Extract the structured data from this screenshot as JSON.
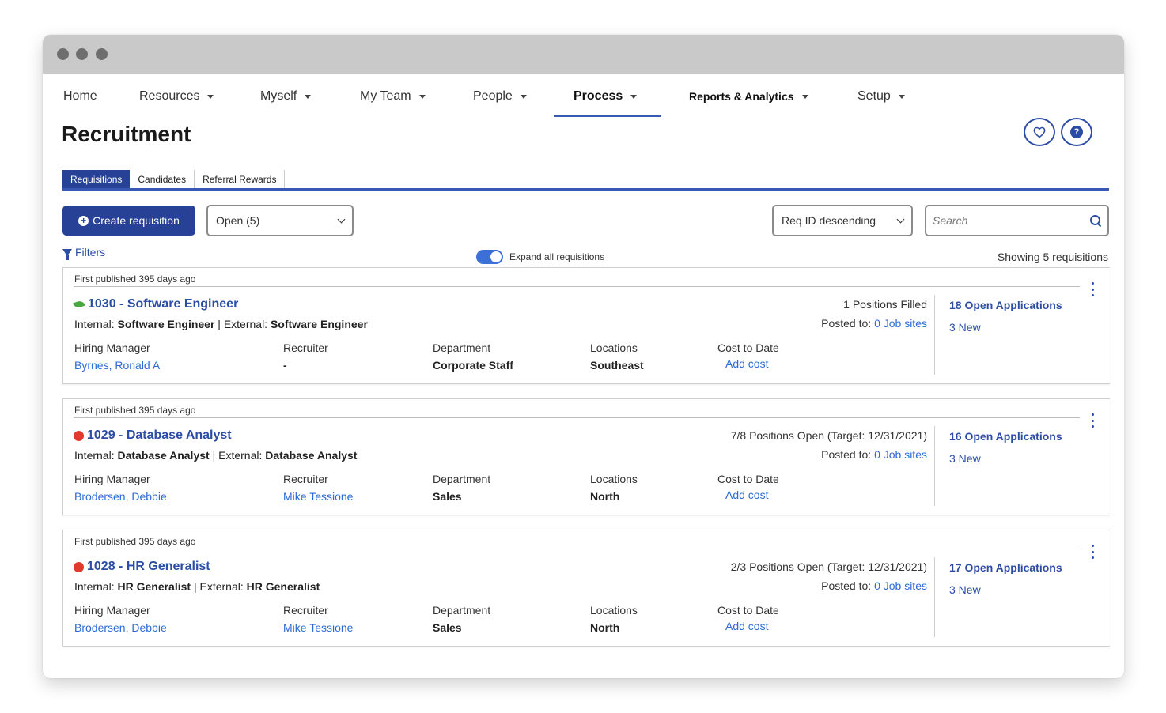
{
  "nav": {
    "items": [
      {
        "label": "Home"
      },
      {
        "label": "Resources"
      },
      {
        "label": "Myself"
      },
      {
        "label": "My Team"
      },
      {
        "label": "People"
      },
      {
        "label": "Process"
      },
      {
        "label": "Reports & Analytics"
      },
      {
        "label": "Setup"
      }
    ],
    "active": "Process"
  },
  "page": {
    "title": "Recruitment"
  },
  "subtabs": [
    {
      "label": "Requisitions"
    },
    {
      "label": "Candidates"
    },
    {
      "label": "Referral Rewards"
    }
  ],
  "toolbar": {
    "create_label": "Create requisition",
    "status_value": "Open (5)",
    "sort_value": "Req ID descending",
    "search_placeholder": "Search",
    "filters_label": "Filters",
    "expand_label": "Expand all requisitions",
    "expand_on": true,
    "showing": "Showing 5 requisitions"
  },
  "colors": {
    "primary": "#264196",
    "link": "#2c6bd6",
    "status_red": "#e03a2f",
    "status_green": "#4aa640"
  },
  "labels": {
    "hiring_manager": "Hiring Manager",
    "recruiter": "Recruiter",
    "department": "Department",
    "locations": "Locations",
    "cost_to_date": "Cost to Date",
    "internal": "Internal:",
    "external": "External:",
    "posted_to": "Posted to:"
  },
  "requisitions": [
    {
      "published": "First published 395 days ago",
      "status_icon": "leaf-icon",
      "title": "1030 - Software Engineer",
      "internal": "Software Engineer",
      "external": "Software Engineer",
      "positions": "1 Positions Filled",
      "job_sites": "0 Job sites",
      "open_apps": "18 Open Applications",
      "new_apps": "3 New",
      "hiring_manager": "Byrnes, Ronald A",
      "recruiter": "-",
      "department": "Corporate Staff",
      "location": "Southeast",
      "cost": "Add cost"
    },
    {
      "published": "First published 395 days ago",
      "status_icon": "red-dot-icon",
      "title": "1029 - Database Analyst",
      "internal": "Database Analyst",
      "external": "Database Analyst",
      "positions": "7/8 Positions Open (Target: 12/31/2021)",
      "job_sites": "0 Job sites",
      "open_apps": "16 Open Applications",
      "new_apps": "3 New",
      "hiring_manager": "Brodersen, Debbie",
      "recruiter": "Mike Tessione",
      "department": "Sales",
      "location": "North",
      "cost": "Add cost"
    },
    {
      "published": "First published 395 days ago",
      "status_icon": "red-dot-icon",
      "title": "1028 - HR Generalist",
      "internal": "HR Generalist",
      "external": "HR Generalist",
      "positions": "2/3 Positions Open (Target: 12/31/2021)",
      "job_sites": "0 Job sites",
      "open_apps": "17 Open Applications",
      "new_apps": "3 New",
      "hiring_manager": "Brodersen, Debbie",
      "recruiter": "Mike Tessione",
      "department": "Sales",
      "location": "North",
      "cost": "Add cost"
    }
  ]
}
